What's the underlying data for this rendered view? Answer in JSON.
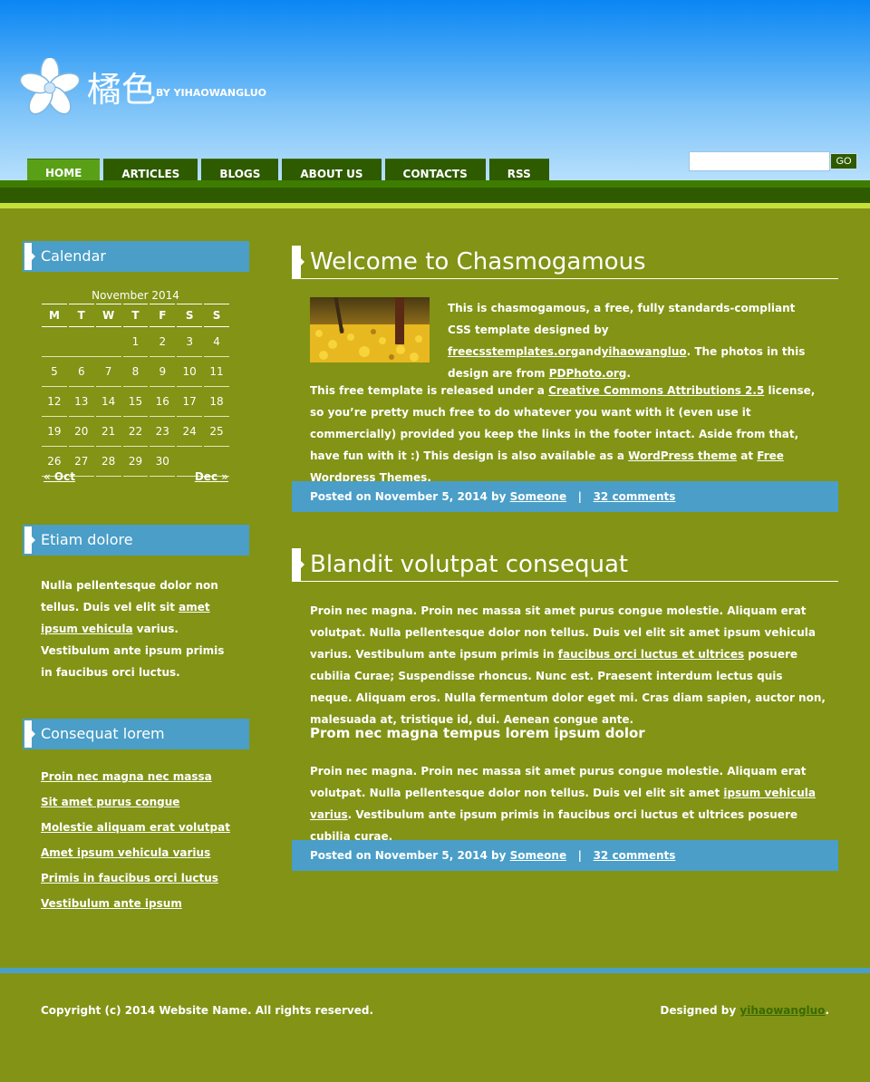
{
  "site": {
    "title": "橘色",
    "by": "BY YIHAOWANGLUO"
  },
  "nav": [
    {
      "label": "HOME",
      "active": true
    },
    {
      "label": "ARTICLES"
    },
    {
      "label": "BLOGS"
    },
    {
      "label": "ABOUT US"
    },
    {
      "label": "CONTACTS"
    },
    {
      "label": "RSS"
    }
  ],
  "search": {
    "value": "",
    "go_label": "GO"
  },
  "sidebar": {
    "calendar": {
      "heading": "Calendar",
      "caption": "November 2014",
      "weekdays": [
        "M",
        "T",
        "W",
        "T",
        "F",
        "S",
        "S"
      ],
      "weeks": [
        [
          "",
          "",
          "",
          "",
          "1",
          "2",
          "3"
        ],
        [
          "4",
          "5",
          "6",
          "7",
          "8",
          "9",
          "10"
        ],
        [
          "11",
          "12",
          "13",
          "14",
          "15",
          "16",
          "17"
        ],
        [
          "18",
          "19",
          "20",
          "21",
          "22",
          "23",
          "24"
        ],
        [
          "25",
          "26",
          "27",
          "28",
          "29",
          "30",
          ""
        ]
      ],
      "display_weeks": [
        [
          "",
          "",
          "",
          "1",
          "2",
          "3",
          "4"
        ],
        [
          "5",
          "6",
          "7",
          "8",
          "9",
          "10",
          "11"
        ],
        [
          "12",
          "13",
          "14",
          "15",
          "16",
          "17",
          "18"
        ],
        [
          "19",
          "20",
          "21",
          "22",
          "23",
          "24",
          "25"
        ],
        [
          "26",
          "27",
          "28",
          "29",
          "30",
          "",
          ""
        ]
      ],
      "prev": "« Oct",
      "next": "Dec »"
    },
    "etiam": {
      "heading": "Etiam dolore",
      "text_before": "Nulla pellentesque dolor non tellus. Duis vel elit sit ",
      "link": "amet ipsum vehicula",
      "text_after": " varius. Vestibulum ante ipsum primis in faucibus orci luctus."
    },
    "consequat": {
      "heading": "Consequat lorem",
      "links": [
        "Proin nec magna nec massa",
        "Sit amet purus congue",
        "Molestie aliquam erat volutpat",
        "Amet ipsum vehicula varius",
        "Primis in faucibus orci luctus",
        "Vestibulum ante ipsum"
      ]
    }
  },
  "posts": [
    {
      "title": "Welcome to Chasmogamous",
      "p1": {
        "t1": "This is ",
        "bold": "chasmogamous",
        "t2": ", a free, fully standards-compliant CSS template designed by ",
        "link1": "freecsstemplates.org",
        "t3": "and",
        "link2": "yihaowangluo",
        "t4": ". The photos in this design are from ",
        "link3": "PDPhoto.org",
        "t5": "."
      },
      "p2": {
        "t1": "This free template is released under a ",
        "link1": "Creative Commons Attributions 2.5",
        "t2": " license, so you’re pretty much free to do whatever you want with it (even use it commercially) provided you keep the links in the footer intact. Aside from that, have fun with it :) This design is also available as a ",
        "link2": "WordPress theme",
        "t3": " at ",
        "link3": "Free Wordpress Themes",
        "t4": "."
      },
      "meta": {
        "posted": "Posted on November 5, 2014 by ",
        "author": "Someone",
        "sep": "|",
        "comments": "32 comments"
      }
    },
    {
      "title": "Blandit volutpat consequat",
      "p1": {
        "t1": "Proin nec magna. Proin nec massa sit amet purus congue molestie. Aliquam erat volutpat. Nulla pellentesque dolor non tellus. Duis vel elit sit amet ipsum vehicula varius. Vestibulum ante ipsum primis in ",
        "link1": "faucibus orci luctus et ultrices",
        "t2": " posuere cubilia Curae; Suspendisse rhoncus. Nunc est. Praesent interdum lectus quis neque. Aliquam eros. Nulla fermentum dolor eget mi. Cras diam sapien, auctor non, malesuada at, tristique id, dui. Aenean congue ante."
      },
      "subheading": "Prom nec magna tempus lorem ipsum dolor",
      "p2": {
        "t1": "Proin nec magna. Proin nec massa sit amet purus congue molestie. Aliquam erat volutpat. Nulla pellentesque dolor non tellus. Duis vel elit sit amet ",
        "link1": "ipsum vehicula varius",
        "t2": ". Vestibulum ante ipsum primis in faucibus orci luctus et ultrices posuere cubilia curae."
      },
      "meta": {
        "posted": "Posted on November 5, 2014 by ",
        "author": "Someone",
        "sep": "|",
        "comments": "32 comments"
      }
    }
  ],
  "footer": {
    "copyright": "Copyright (c) 2014 Website Name. All rights reserved.",
    "designed_by": "Designed by ",
    "designer_link": "yihaowangluo",
    "end": "."
  },
  "colors": {
    "background": "#829316",
    "accent_blue": "#4a9ec8",
    "nav_dark": "#2e5a00",
    "nav_active": "#5aa017",
    "lime": "#c6e03a"
  }
}
